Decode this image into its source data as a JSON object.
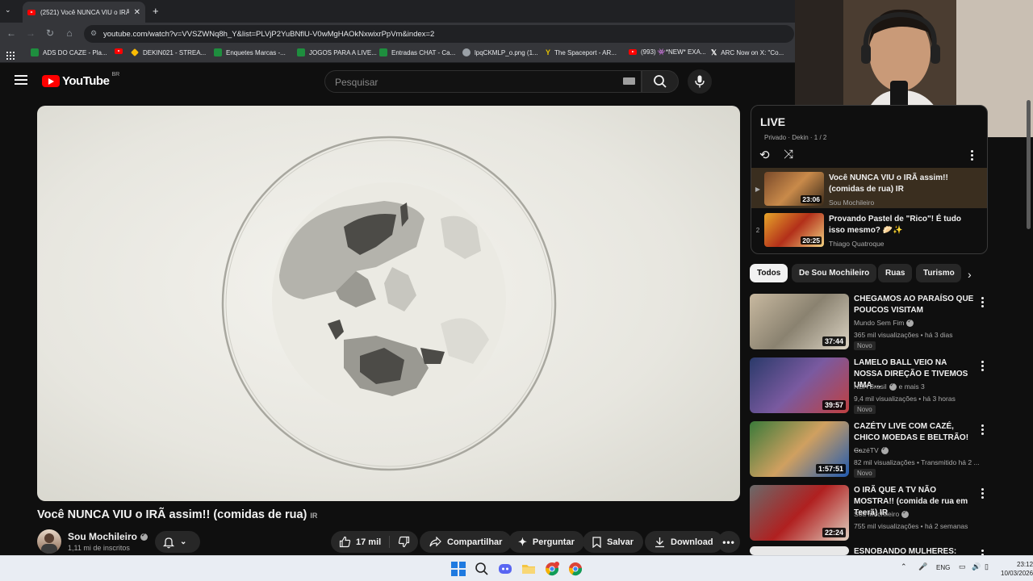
{
  "browser": {
    "tab_title": "(2521) Você NUNCA VIU o IRÃ",
    "url": "youtube.com/watch?v=VVSZWNq8h_Y&list=PLVjP2YuBNflU-V0wMgHAOkNxwixrPpVm&index=2",
    "bookmarks": [
      {
        "label": "ADS DO CAZE - Pla...",
        "icon": "sheets-icon",
        "color": "#1e8e3e"
      },
      {
        "label": "",
        "icon": "youtube-icon",
        "color": "#ff0000"
      },
      {
        "label": "DEKIN021 - STREA...",
        "icon": "drive-icon",
        "color": "#fbbc04"
      },
      {
        "label": "Enquetes Marcas -...",
        "icon": "sheets-icon",
        "color": "#1e8e3e"
      },
      {
        "label": "JOGOS PARA A LIVE...",
        "icon": "sheets-icon",
        "color": "#1e8e3e"
      },
      {
        "label": "Entradas CHAT - Ca...",
        "icon": "sheets-icon",
        "color": "#1e8e3e"
      },
      {
        "label": "lpqCKMLP_o.png (1...",
        "icon": "globe-icon",
        "color": "#9aa0a6"
      },
      {
        "label": "The Spaceport - AR...",
        "icon": "spaceport-icon",
        "color": "#e6c200"
      },
      {
        "label": "(993) 👾*NEW* EXA...",
        "icon": "youtube-icon",
        "color": "#ff0000"
      },
      {
        "label": "ARC Now on X: \"Co...",
        "icon": "x-icon",
        "color": "#ffffff"
      }
    ]
  },
  "youtube": {
    "logo_text": "YouTube",
    "country": "BR",
    "search_placeholder": "Pesquisar"
  },
  "video": {
    "title": "Você NUNCA VIU o IRÃ assim!! (comidas de rua)",
    "title_badge": "IR",
    "channel": "Sou Mochileiro",
    "subscribers": "1,11 mi de inscritos",
    "likes": "17 mil",
    "share_label": "Compartilhar",
    "ask_label": "Perguntar",
    "save_label": "Salvar",
    "download_label": "Download"
  },
  "playlist": {
    "title": "LIVE",
    "subtitle": "Privado · Dekin · 1 / 2",
    "items": [
      {
        "index": "▶",
        "title": "Você NUNCA VIU o IRÃ assim!! (comidas de rua) IR",
        "channel": "Sou Mochileiro",
        "duration": "23:06",
        "active": true
      },
      {
        "index": "2",
        "title": "Provando Pastel de \"Rico\"! É tudo isso mesmo? 🥟✨",
        "channel": "Thiago Quatroque",
        "duration": "20:25",
        "active": false
      }
    ]
  },
  "chips": [
    "Todos",
    "De Sou Mochileiro",
    "Ruas",
    "Turismo"
  ],
  "recommendations": [
    {
      "title": "CHEGAMOS AO PARAÍSO QUE POUCOS VISITAM",
      "channel": "Mundo Sem Fim",
      "verified": true,
      "meta": "365 mil visualizações • há 3 dias",
      "duration": "37:44",
      "new": "Novo"
    },
    {
      "title": "LAMELO BALL VEIO NA NOSSA DIREÇÃO E TIVEMOS UMA ...",
      "channel": "NBA Brasil",
      "verified": true,
      "channel_extra": "e mais 3",
      "meta": "9,4 mil visualizações • há 3 horas",
      "duration": "39:57",
      "new": "Novo"
    },
    {
      "title": "CAZÉTV LIVE COM CAZÉ, CHICO MOEDAS E BELTRÃO! ...",
      "channel": "CazéTV",
      "verified": true,
      "meta": "82 mil visualizações • Transmitido há 2 ...",
      "duration": "1:57:51",
      "new": "Novo"
    },
    {
      "title": "O IRÃ QUE A TV NÃO MOSTRA!! (comida de rua em Teerã) IR",
      "channel": "Sou Mochileiro",
      "verified": true,
      "meta": "755 mil visualizações • há 2 semanas",
      "duration": "22:24",
      "new": ""
    },
    {
      "title": "ESNOBANDO MULHERES:",
      "channel": "",
      "verified": false,
      "meta": "",
      "duration": "",
      "new": ""
    }
  ],
  "taskbar": {
    "lang": "ENG",
    "time": "23:12",
    "date": "10/03/2026"
  }
}
